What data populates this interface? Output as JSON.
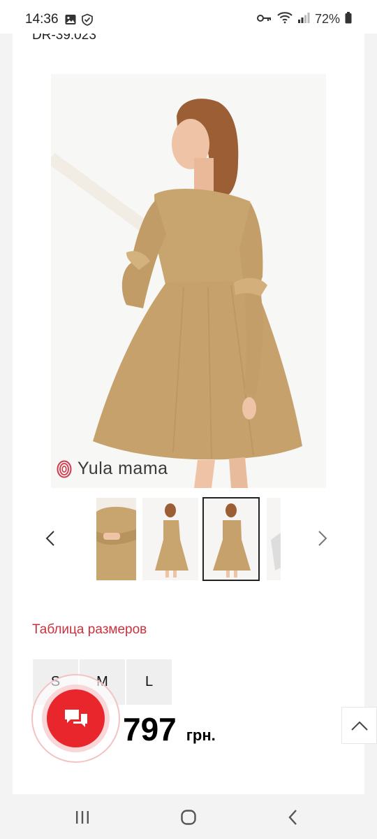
{
  "status_bar": {
    "time": "14:36",
    "battery": "72%",
    "icons": [
      "image-icon",
      "shield-check-icon",
      "key-icon",
      "wifi-icon",
      "signal-icon",
      "battery-icon"
    ]
  },
  "product": {
    "sku": "DR-39.023",
    "brand": "Yula mama",
    "size_table_label": "Таблица размеров",
    "sizes": [
      "S",
      "M",
      "L"
    ],
    "price": "797",
    "currency": "грн."
  },
  "gallery": {
    "thumb_count": 4,
    "selected_index": 2
  },
  "colors": {
    "accent": "#e8262c",
    "link": "#c8323e",
    "dress": "#c8a46e"
  }
}
